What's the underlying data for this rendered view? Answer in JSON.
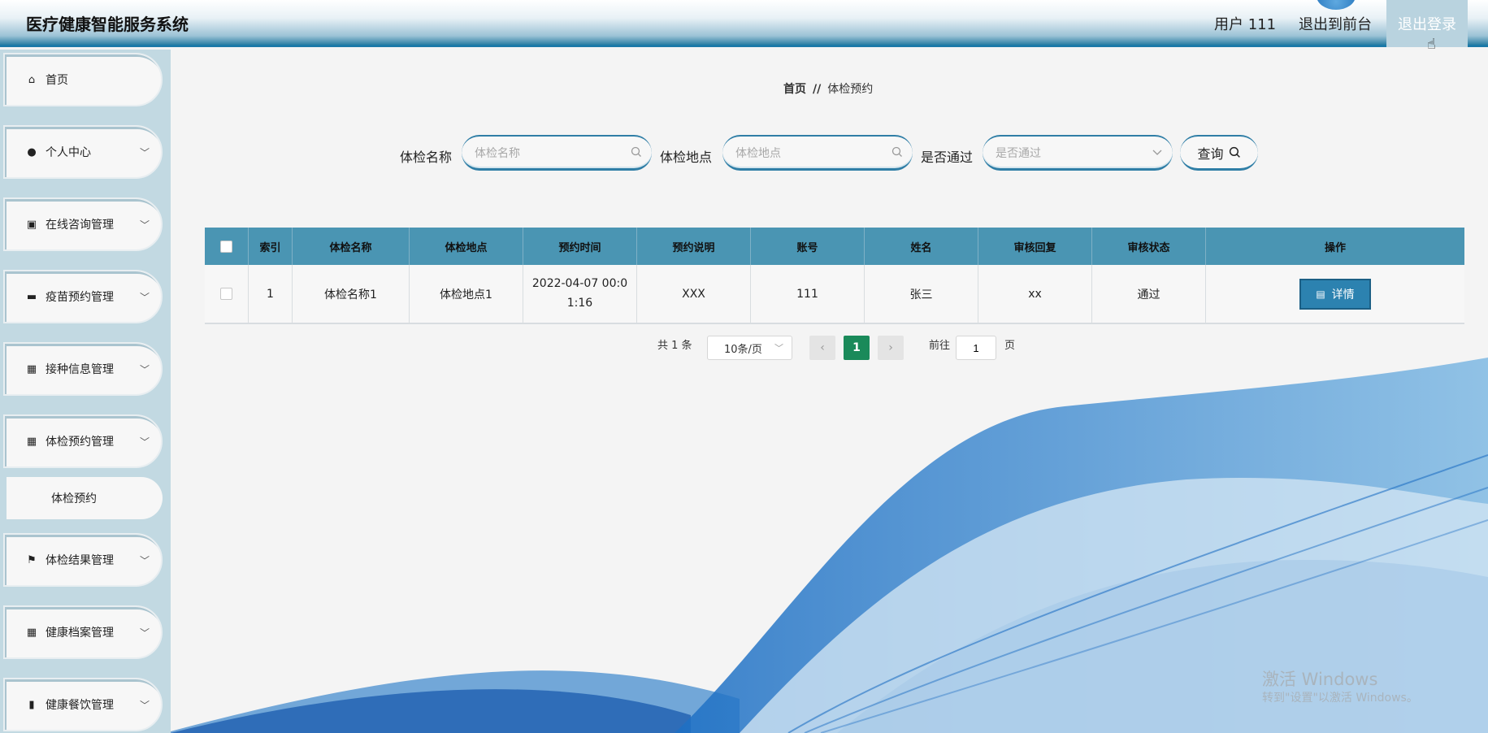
{
  "header": {
    "title": "医疗健康智能服务系统",
    "user": "用户 111",
    "front": "退出到前台",
    "logout": "退出登录"
  },
  "sidebar": {
    "items": [
      {
        "label": "首页",
        "icon": "home-icon"
      },
      {
        "label": "个人中心",
        "icon": "user-icon"
      },
      {
        "label": "在线咨询管理",
        "icon": "clipboard-icon"
      },
      {
        "label": "疫苗预约管理",
        "icon": "briefcase-icon"
      },
      {
        "label": "接种信息管理",
        "icon": "grid-icon"
      },
      {
        "label": "体检预约管理",
        "icon": "apps-icon"
      },
      {
        "label": "体检预约",
        "icon": ""
      },
      {
        "label": "体检结果管理",
        "icon": "flag-icon"
      },
      {
        "label": "健康档案管理",
        "icon": "grid-icon"
      },
      {
        "label": "健康餐饮管理",
        "icon": "bar-chart-icon"
      }
    ]
  },
  "breadcrumb": {
    "home": "首页",
    "sep": "//",
    "current": "体检预约"
  },
  "search": {
    "name_label": "体检名称",
    "name_placeholder": "体检名称",
    "place_label": "体检地点",
    "place_placeholder": "体检地点",
    "pass_label": "是否通过",
    "pass_placeholder": "是否通过",
    "query": "查询"
  },
  "table": {
    "headers": [
      "索引",
      "体检名称",
      "体检地点",
      "预约时间",
      "预约说明",
      "账号",
      "姓名",
      "审核回复",
      "审核状态",
      "操作"
    ],
    "rows": [
      {
        "index": "1",
        "name": "体检名称1",
        "place": "体检地点1",
        "time": "2022-04-07 00:01:16",
        "desc": "XXX",
        "account": "111",
        "username": "张三",
        "reply": "xx",
        "status": "通过",
        "action": "详情"
      }
    ]
  },
  "pagination": {
    "total": "共 1 条",
    "size": "10条/页",
    "current": "1",
    "goto": "前往",
    "goto_value": "1",
    "page_unit": "页"
  },
  "watermark": {
    "line1": "激活 Windows",
    "line2": "转到\"设置\"以激活 Windows。"
  }
}
